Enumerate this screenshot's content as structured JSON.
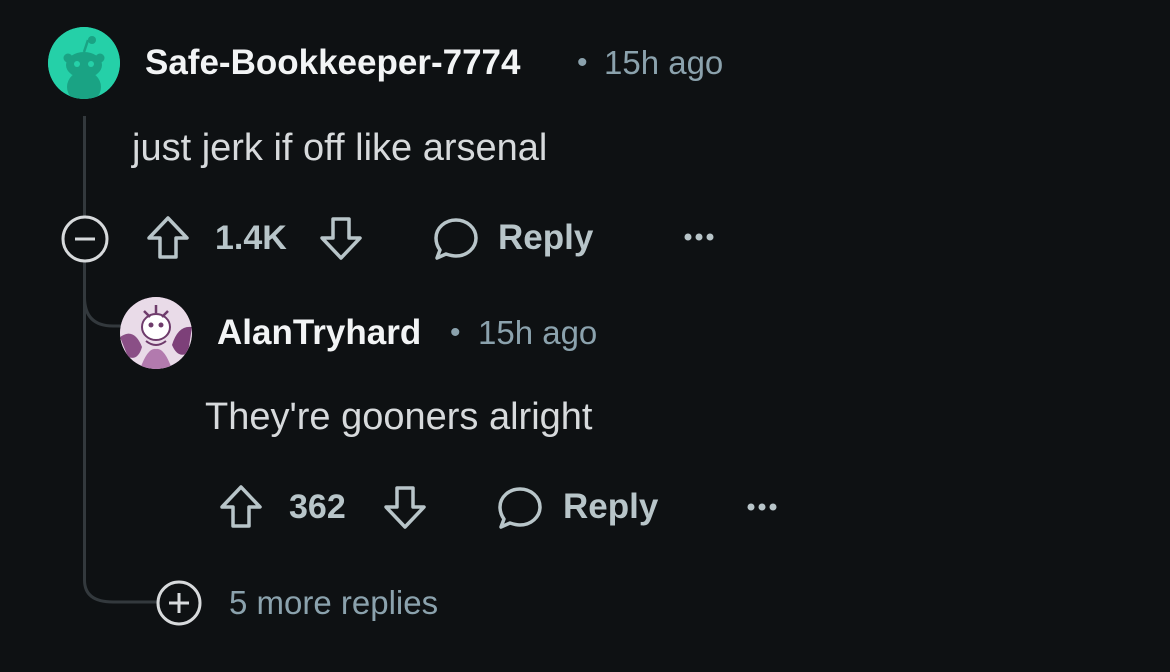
{
  "comment": {
    "username": "Safe-Bookkeeper-7774",
    "separator": "•",
    "time": "15h ago",
    "text": "just jerk if off like arsenal",
    "votes": "1.4K",
    "reply_label": "Reply",
    "avatar_color": "#25d0a8"
  },
  "reply": {
    "username": "AlanTryhard",
    "separator": "•",
    "time": "15h ago",
    "text": "They're gooners alright",
    "votes": "362",
    "reply_label": "Reply"
  },
  "more_replies": "5 more replies",
  "icons": [
    "collapse-icon",
    "upvote-icon",
    "downvote-icon",
    "comment-bubble-icon",
    "more-options-icon",
    "expand-icon"
  ],
  "colors": {
    "background": "#0e1113",
    "muted": "#8ba2ad",
    "text": "#d7dadc",
    "thread_line": "#33393d"
  }
}
